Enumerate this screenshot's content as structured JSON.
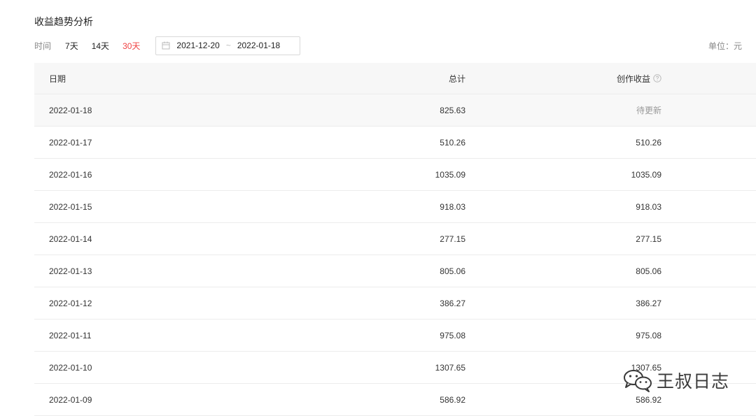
{
  "page": {
    "title": "收益趋势分析"
  },
  "filter": {
    "time_label": "时间",
    "ranges": [
      "7天",
      "14天",
      "30天"
    ],
    "active_range": "30天",
    "start_date": "2021-12-20",
    "separator": "~",
    "end_date": "2022-01-18",
    "unit": "单位：元"
  },
  "table": {
    "columns": [
      "日期",
      "总计",
      "创作收益"
    ],
    "rows": [
      {
        "date": "2022-01-18",
        "total": "825.63",
        "earnings": "待更新"
      },
      {
        "date": "2022-01-17",
        "total": "510.26",
        "earnings": "510.26"
      },
      {
        "date": "2022-01-16",
        "total": "1035.09",
        "earnings": "1035.09"
      },
      {
        "date": "2022-01-15",
        "total": "918.03",
        "earnings": "918.03"
      },
      {
        "date": "2022-01-14",
        "total": "277.15",
        "earnings": "277.15"
      },
      {
        "date": "2022-01-13",
        "total": "805.06",
        "earnings": "805.06"
      },
      {
        "date": "2022-01-12",
        "total": "386.27",
        "earnings": "386.27"
      },
      {
        "date": "2022-01-11",
        "total": "975.08",
        "earnings": "975.08"
      },
      {
        "date": "2022-01-10",
        "total": "1307.65",
        "earnings": "1307.65"
      },
      {
        "date": "2022-01-09",
        "total": "586.92",
        "earnings": "586.92"
      }
    ]
  },
  "watermark": {
    "text": "王叔日志",
    "icon": "wechat-icon"
  },
  "colors": {
    "accent": "#f04142",
    "header_bg": "#f7f7f7",
    "muted": "#999999"
  }
}
